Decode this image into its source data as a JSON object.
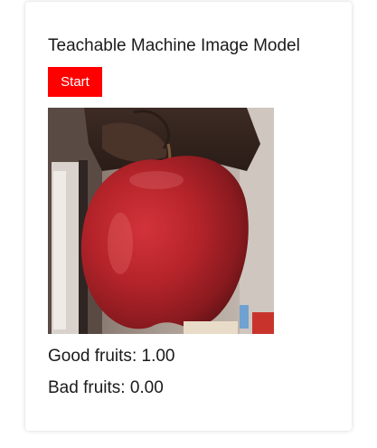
{
  "app": {
    "title": "Teachable Machine Image Model",
    "start_button_label": "Start",
    "accent_color": "#ff0000"
  },
  "webcam": {
    "subject": "red apple held in hand",
    "icon": "webcam-feed"
  },
  "predictions": [
    {
      "class_name": "Good fruits",
      "probability": "1.00"
    },
    {
      "class_name": "Bad fruits",
      "probability": "0.00"
    }
  ]
}
